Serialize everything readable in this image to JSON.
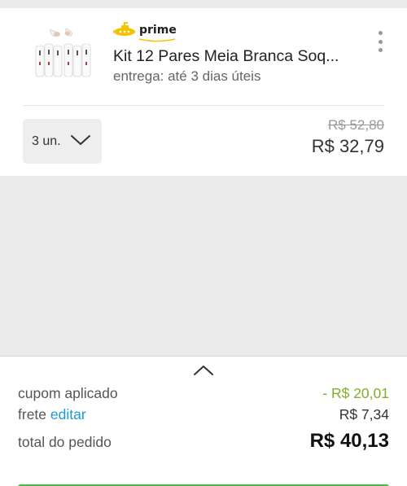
{
  "product": {
    "badge": "prime",
    "title": "Kit 12 Pares Meia Branca Soq...",
    "delivery": "entrega: até 3 dias úteis",
    "quantity": "3 un.",
    "old_price": "R$ 52,80",
    "price": "R$ 32,79"
  },
  "summary": {
    "coupon_label": "cupom aplicado",
    "coupon_value": "- R$ 20,01",
    "shipping_label": "frete",
    "shipping_edit": "editar",
    "shipping_value": "R$ 7,34",
    "total_label": "total do pedido",
    "total_value": "R$ 40,13"
  },
  "icons": {
    "badge_icon": "submarine-icon",
    "more": "more-vertical-icon",
    "quantity_dropdown": "chevron-down-icon",
    "expand": "chevron-up-icon"
  },
  "colors": {
    "badge_yellow": "#f5c400",
    "discount_green": "#7fb02a",
    "link_blue": "#1d9bd1",
    "cta_green": "#40c240"
  }
}
